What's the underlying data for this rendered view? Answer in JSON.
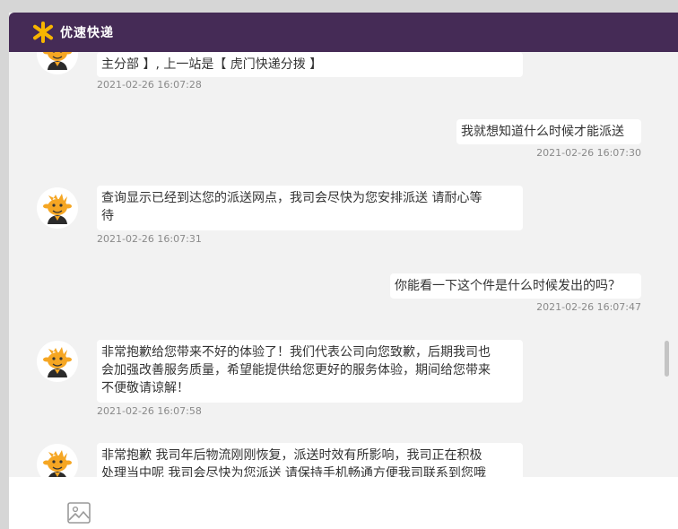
{
  "app": {
    "brand_name": "优速快递",
    "accent_color": "#452b56"
  },
  "messages": [
    {
      "side": "agent",
      "text": "主分部 】, 上一站是【 虎门快递分拨 】",
      "time": "2021-02-26 16:07:28"
    },
    {
      "side": "user",
      "text": "我就想知道什么时候才能派送",
      "time": "2021-02-26 16:07:30"
    },
    {
      "side": "agent",
      "lines": [
        "查询显示已经到达您的派送网点，我司会尽快为您安排派送 请耐心等",
        "待"
      ],
      "time": "2021-02-26 16:07:31"
    },
    {
      "side": "user",
      "text": "你能看一下这个件是什么时候发出的吗？",
      "time": "2021-02-26 16:07:47"
    },
    {
      "side": "agent",
      "lines": [
        "非常抱歉给您带来不好的体验了！我们代表公司向您致歉，后期我司也",
        "会加强改善服务质量，希望能提供给您更好的服务体验，期间给您带来",
        "不便敬请谅解！"
      ],
      "time": "2021-02-26 16:07:58"
    },
    {
      "side": "agent",
      "lines": [
        "非常抱歉 我司年后物流刚刚恢复，派送时效有所影响，我司正在积极",
        "处理当中呢 我司会尽快为您派送 请保持手机畅通方便我司联系到您哦"
      ]
    }
  ],
  "input": {
    "image_icon": "image-icon"
  }
}
